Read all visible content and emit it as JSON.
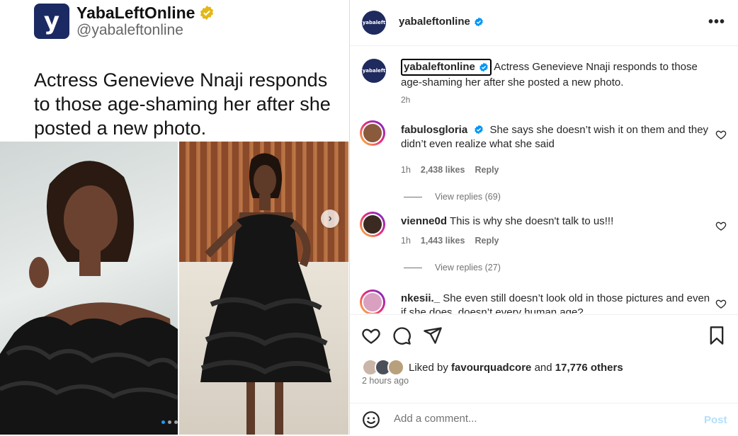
{
  "tweet": {
    "avatar_letter": "y",
    "display_name": "YabaLeftOnline",
    "handle": "@yabaleftonline",
    "text": "Actress Genevieve Nnaji responds to those age-shaming her after she posted a new photo.",
    "next_glyph": "›"
  },
  "post": {
    "avatar_text": "yabaleft",
    "username": "yabaleftonline",
    "more_glyph": "•••",
    "caption_user": "yabaleftonline",
    "caption_text": "Actress Genevieve Nnaji responds to those age-shaming her after she posted a new photo.",
    "caption_time": "2h"
  },
  "comments": [
    {
      "user": "fabulosgloria",
      "verified": true,
      "text": "She says she doesn’t wish it on them and they didn’t even realize what she said",
      "time": "1h",
      "likes": "2,438 likes",
      "reply": "Reply",
      "view_replies": "View replies (69)",
      "avatar_color": "#8a5a3c"
    },
    {
      "user": "vienne0d",
      "verified": false,
      "text": "This is why she doesn't talk to us!!!",
      "time": "1h",
      "likes": "1,443 likes",
      "reply": "Reply",
      "view_replies": "View replies (27)",
      "avatar_color": "#3a2a22"
    },
    {
      "user": "nkesii._",
      "verified": false,
      "text": "She even still doesn’t look old in those pictures and even if she does, doesn’t every human age?",
      "avatar_color": "#d9a0c0"
    }
  ],
  "likes": {
    "prefix": "Liked by ",
    "user": "favourquadcore",
    "middle": " and ",
    "others": "17,776 others",
    "avatar_colors": [
      "#c9b6a8",
      "#4a4f5a",
      "#b8a07c"
    ]
  },
  "post_time": "2 hours ago",
  "add_comment": {
    "placeholder": "Add a comment...",
    "post_label": "Post"
  },
  "colors": {
    "verified_blue": "#0095f6",
    "tweet_gold": "#e2b719",
    "brand_navy": "#1f2a5e"
  }
}
